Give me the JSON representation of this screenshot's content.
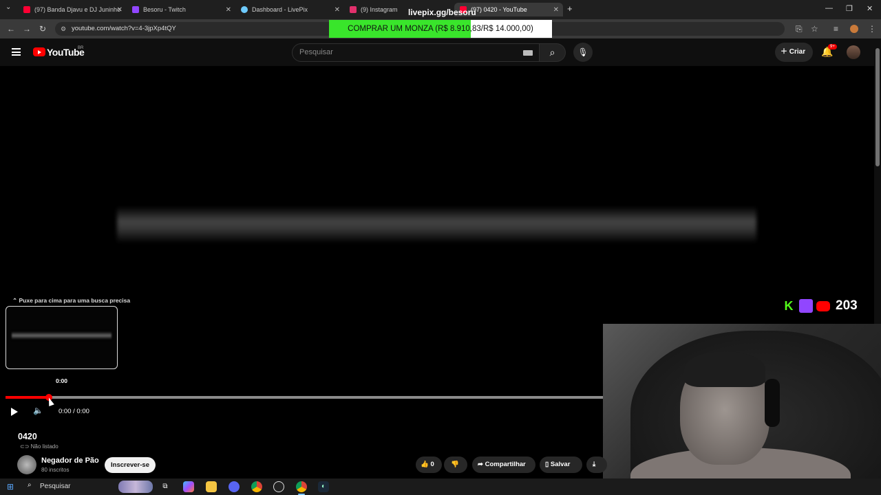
{
  "browser": {
    "tabs": [
      {
        "title": "(97) Banda Djavu e DJ Juninho",
        "close": "✕",
        "favicon_color": "#ff0033"
      },
      {
        "title": "Besoru - Twitch",
        "close": "✕",
        "favicon_color": "#9146ff"
      },
      {
        "title": "Dashboard - LivePix",
        "close": "✕",
        "favicon_color": "#6ecbff"
      },
      {
        "title": "(9) Instagram",
        "close": "✕",
        "favicon_color": "#e1306c"
      },
      {
        "title": "(97) 0420 - YouTube",
        "close": "✕",
        "favicon_color": "#ff0033"
      }
    ],
    "new_tab": "+",
    "url": "youtube.com/watch?v=4-3jpXp4tQY",
    "window_controls": [
      "—",
      "❐",
      "✕"
    ]
  },
  "overlay": {
    "livepix_label": "livepix.gg/besoru",
    "donation_goal_text": "COMPRAR UM MONZA (R$ 8.910,83/R$ 14.000,00)",
    "donation_progress": 0.6365,
    "donation_fill_color": "#39e52b",
    "viewer_count": "203",
    "platform_icons": [
      "kick-icon",
      "twitch-icon",
      "youtube-icon"
    ]
  },
  "youtube": {
    "logo_text": "YouTube",
    "country_code": "BR",
    "search_placeholder": "Pesquisar",
    "create_label": "Criar",
    "notifications_badge": "9+",
    "accent_color": "#ff0000"
  },
  "player": {
    "swipe_hint": "⌃ Puxe para cima para uma busca precisa",
    "preview_time": "0:00",
    "timecode": "0:00 / 0:00",
    "progress": 0.07
  },
  "video": {
    "title": "0420",
    "visibility": "Não listado",
    "channel_name": "Negador de Pão",
    "subscribers": "80 inscritos",
    "subscribe_label": "Inscrever-se",
    "like_count": "0",
    "share_label": "Compartilhar",
    "save_label": "Salvar"
  },
  "taskbar": {
    "search_label": "Pesquisar",
    "apps": [
      "task-view-icon",
      "copilot-icon",
      "file-explorer-icon",
      "discord-icon",
      "chrome-icon",
      "obs-icon",
      "chrome-active-icon",
      "steam-icon"
    ]
  }
}
